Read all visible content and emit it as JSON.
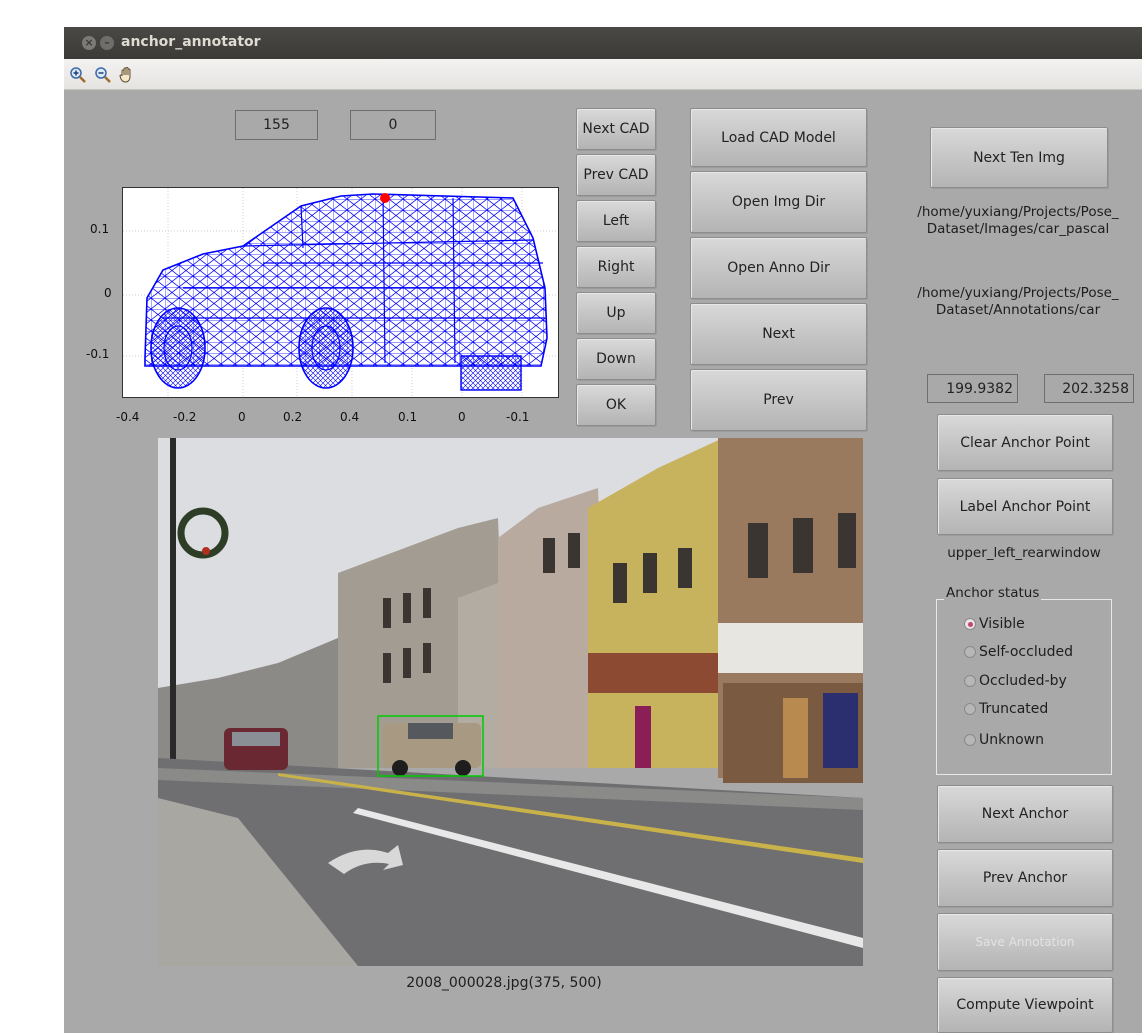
{
  "window": {
    "title": "anchor_annotator"
  },
  "toolbar": {
    "icons": [
      "zoom-in-icon",
      "zoom-out-icon",
      "pan-hand-icon"
    ]
  },
  "fields": {
    "cad_index": "155",
    "azimuth_offset": "0",
    "coord_x": "199.9382",
    "coord_y": "202.3258"
  },
  "cad_buttons": {
    "next_cad": "Next CAD",
    "prev_cad": "Prev CAD",
    "left": "Left",
    "right": "Right",
    "up": "Up",
    "down": "Down",
    "ok": "OK"
  },
  "main_buttons": {
    "load_cad": "Load CAD Model",
    "open_img_dir": "Open Img Dir",
    "open_anno_dir": "Open Anno Dir",
    "next": "Next",
    "prev": "Prev"
  },
  "right_panel": {
    "next_ten": "Next Ten Img",
    "img_dir_path": [
      "/home/yuxiang/Projects/Pose_",
      "Dataset/Images/car_pascal"
    ],
    "anno_dir_path": [
      "/home/yuxiang/Projects/Pose_",
      "Dataset/Annotations/car"
    ],
    "clear_anchor": "Clear Anchor Point",
    "label_anchor": "Label Anchor Point",
    "anchor_name": "upper_left_rearwindow",
    "next_anchor": "Next Anchor",
    "prev_anchor": "Prev Anchor",
    "save_annotation": "Save Annotation",
    "compute_viewpoint": "Compute Viewpoint"
  },
  "anchor_status": {
    "title": "Anchor status",
    "options": [
      "Visible",
      "Self-occluded",
      "Occluded-by",
      "Truncated",
      "Unknown"
    ],
    "selected": "Visible"
  },
  "cad_plot": {
    "y_ticks": [
      "0.1",
      "0",
      "-0.1"
    ],
    "x_ticks": [
      "-0.4",
      "-0.2",
      "0",
      "0.2",
      "0.4",
      "0.1",
      "0",
      "-0.1"
    ]
  },
  "image_caption": "2008_000028.jpg(375, 500)",
  "colors": {
    "wireframe": "#0000ff",
    "anchor": "#ff0000",
    "bbox": "#00cc00",
    "window_bg": "#a9a9a9"
  }
}
